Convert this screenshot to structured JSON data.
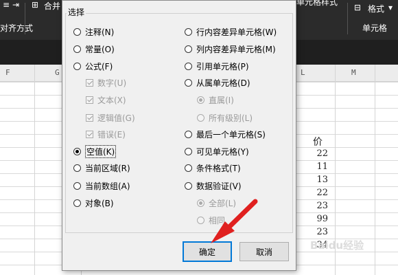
{
  "ribbon": {
    "merge_label": "合并",
    "cell_style_label": "单元格样式",
    "format_label": "格式",
    "alignment_label": "对齐方式",
    "cells_group_label": "单元格"
  },
  "sheet": {
    "columns": [
      "F",
      "G",
      "L",
      "M"
    ],
    "header_fragment": "价",
    "values": [
      "22",
      "11",
      "13",
      "22",
      "23",
      "99",
      "23",
      "34"
    ]
  },
  "dialog": {
    "title": "选择",
    "left_options": [
      {
        "label": "注释(N)",
        "type": "radio",
        "checked": false,
        "disabled": false
      },
      {
        "label": "常量(O)",
        "type": "radio",
        "checked": false,
        "disabled": false
      },
      {
        "label": "公式(F)",
        "type": "radio",
        "checked": false,
        "disabled": false
      },
      {
        "label": "数字(U)",
        "type": "checkbox",
        "checked": true,
        "disabled": true
      },
      {
        "label": "文本(X)",
        "type": "checkbox",
        "checked": true,
        "disabled": true
      },
      {
        "label": "逻辑值(G)",
        "type": "checkbox",
        "checked": true,
        "disabled": true
      },
      {
        "label": "错误(E)",
        "type": "checkbox",
        "checked": true,
        "disabled": true
      },
      {
        "label": "空值(K)",
        "type": "radio",
        "checked": true,
        "disabled": false
      },
      {
        "label": "当前区域(R)",
        "type": "radio",
        "checked": false,
        "disabled": false
      },
      {
        "label": "当前数组(A)",
        "type": "radio",
        "checked": false,
        "disabled": false
      },
      {
        "label": "对象(B)",
        "type": "radio",
        "checked": false,
        "disabled": false
      }
    ],
    "right_options": [
      {
        "label": "行内容差异单元格(W)",
        "type": "radio",
        "checked": false,
        "disabled": false
      },
      {
        "label": "列内容差异单元格(M)",
        "type": "radio",
        "checked": false,
        "disabled": false
      },
      {
        "label": "引用单元格(P)",
        "type": "radio",
        "checked": false,
        "disabled": false
      },
      {
        "label": "从属单元格(D)",
        "type": "radio",
        "checked": false,
        "disabled": false
      },
      {
        "label": "直属(I)",
        "type": "radio",
        "checked": true,
        "disabled": true
      },
      {
        "label": "所有级别(L)",
        "type": "radio",
        "checked": false,
        "disabled": true
      },
      {
        "label": "最后一个单元格(S)",
        "type": "radio",
        "checked": false,
        "disabled": false
      },
      {
        "label": "可见单元格(Y)",
        "type": "radio",
        "checked": false,
        "disabled": false
      },
      {
        "label": "条件格式(T)",
        "type": "radio",
        "checked": false,
        "disabled": false
      },
      {
        "label": "数据验证(V)",
        "type": "radio",
        "checked": false,
        "disabled": false
      },
      {
        "label": "全部(L)",
        "type": "radio",
        "checked": true,
        "disabled": true
      },
      {
        "label": "相同",
        "type": "radio",
        "checked": false,
        "disabled": true
      }
    ],
    "ok_label": "确定",
    "cancel_label": "取消"
  },
  "watermark": "Baidu经验",
  "colors": {
    "accent": "#0078d7",
    "arrow": "#e0201f",
    "ribbon_bg": "#2b2b2b"
  }
}
